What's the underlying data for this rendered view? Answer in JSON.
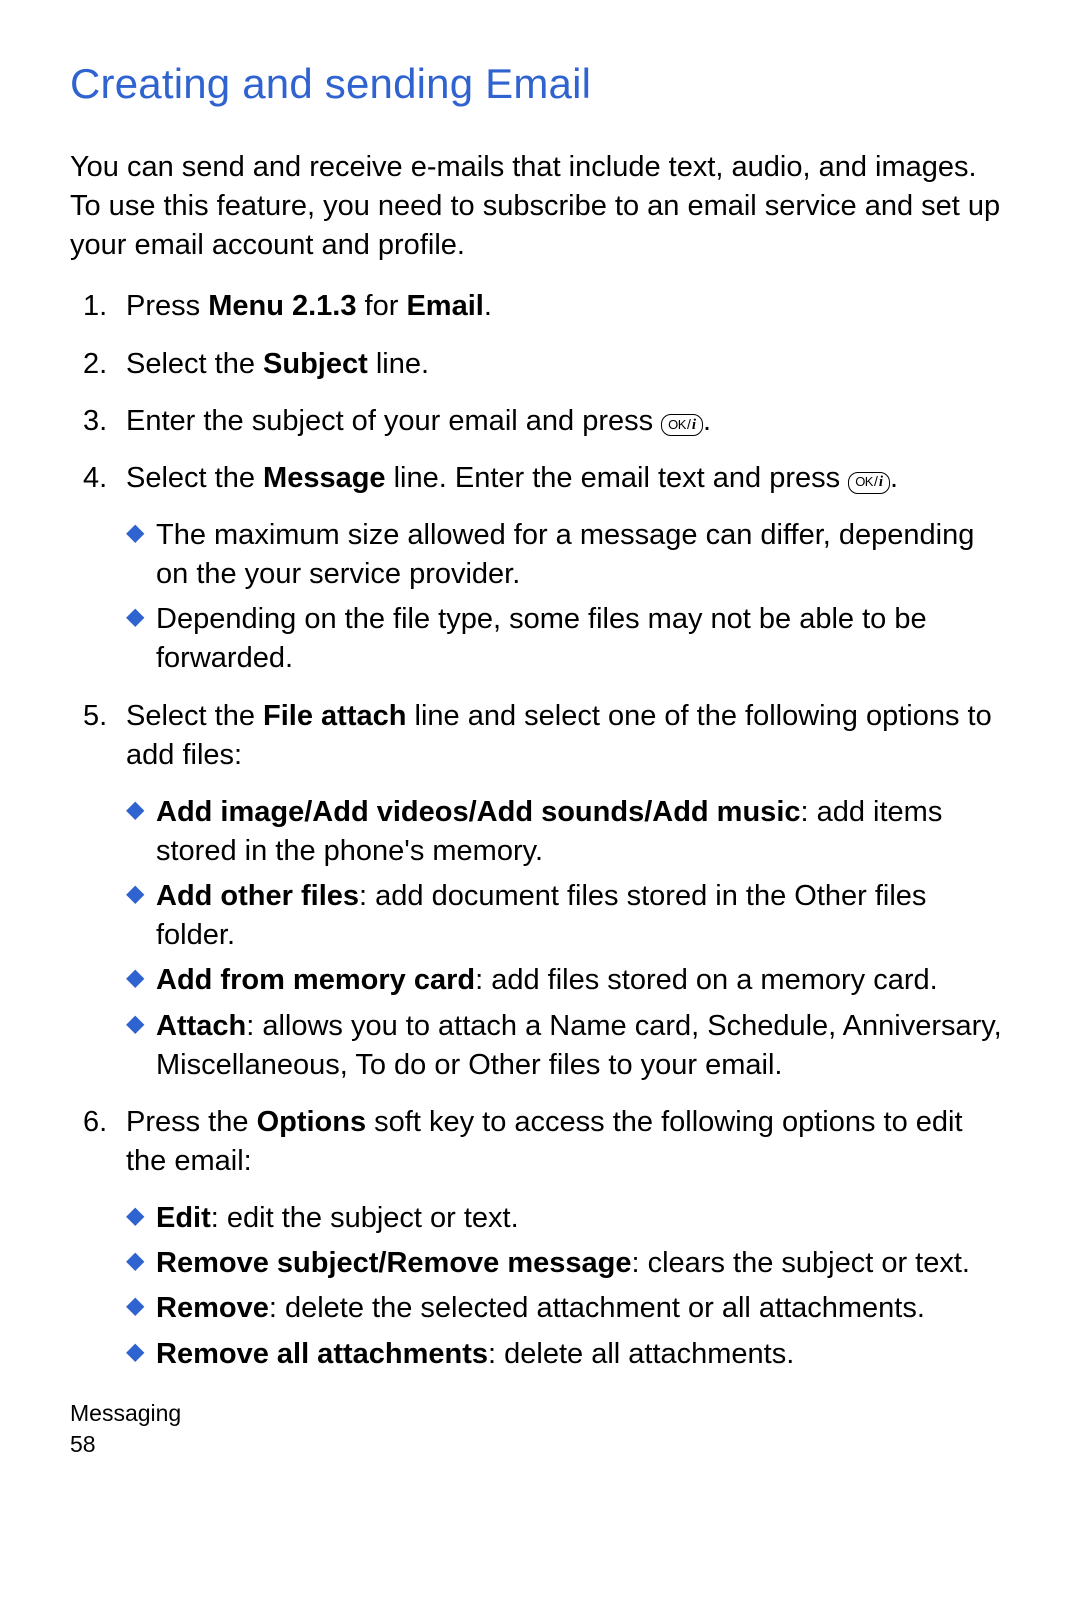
{
  "title": "Creating and sending Email",
  "intro": "You can send and receive e-mails that include text, audio, and images. To use this feature, you need to subscribe to an email service and set up your email account and profile.",
  "ok_key": {
    "ok": "OK",
    "slash": "/",
    "i": "i"
  },
  "steps": {
    "s1": {
      "a": "Press ",
      "b": "Menu 2.1.3",
      "c": " for ",
      "d": "Email",
      "e": "."
    },
    "s2": {
      "a": "Select the ",
      "b": "Subject",
      "c": " line."
    },
    "s3": {
      "a": "Enter the subject of your email and press  ",
      "b": "."
    },
    "s4": {
      "a": "Select the ",
      "b": "Message",
      "c": " line. Enter the email text and press  ",
      "d": ".",
      "bullets": [
        "The maximum size allowed for a message can differ, depending on the your service provider.",
        "Depending on the file type, some files may not be able to be forwarded."
      ]
    },
    "s5": {
      "a": "Select the ",
      "b": "File attach",
      "c": " line and select one of the following options to add files:",
      "bullets": [
        {
          "b": "Add image/Add videos/Add sounds/Add music",
          "t": ": add items stored in the phone's memory."
        },
        {
          "b": "Add other files",
          "t": ": add document files stored in the Other files folder."
        },
        {
          "b": "Add from memory card",
          "t": ": add files stored on a memory card."
        },
        {
          "b": "Attach",
          "t": ": allows you to attach a Name card, Schedule, Anniversary, Miscellaneous, To do or Other files to your email."
        }
      ]
    },
    "s6": {
      "a": "Press the ",
      "b": "Options",
      "c": " soft key to access the following options to edit the email:",
      "bullets": [
        {
          "b": "Edit",
          "t": ": edit the subject or text."
        },
        {
          "b": "Remove subject/Remove message",
          "t": ": clears the subject or text."
        },
        {
          "b": "Remove",
          "t": ": delete the selected attachment or all attachments."
        },
        {
          "b": "Remove all attachments",
          "t": ": delete all attachments."
        }
      ]
    }
  },
  "footer": {
    "section": "Messaging",
    "page": "58"
  }
}
